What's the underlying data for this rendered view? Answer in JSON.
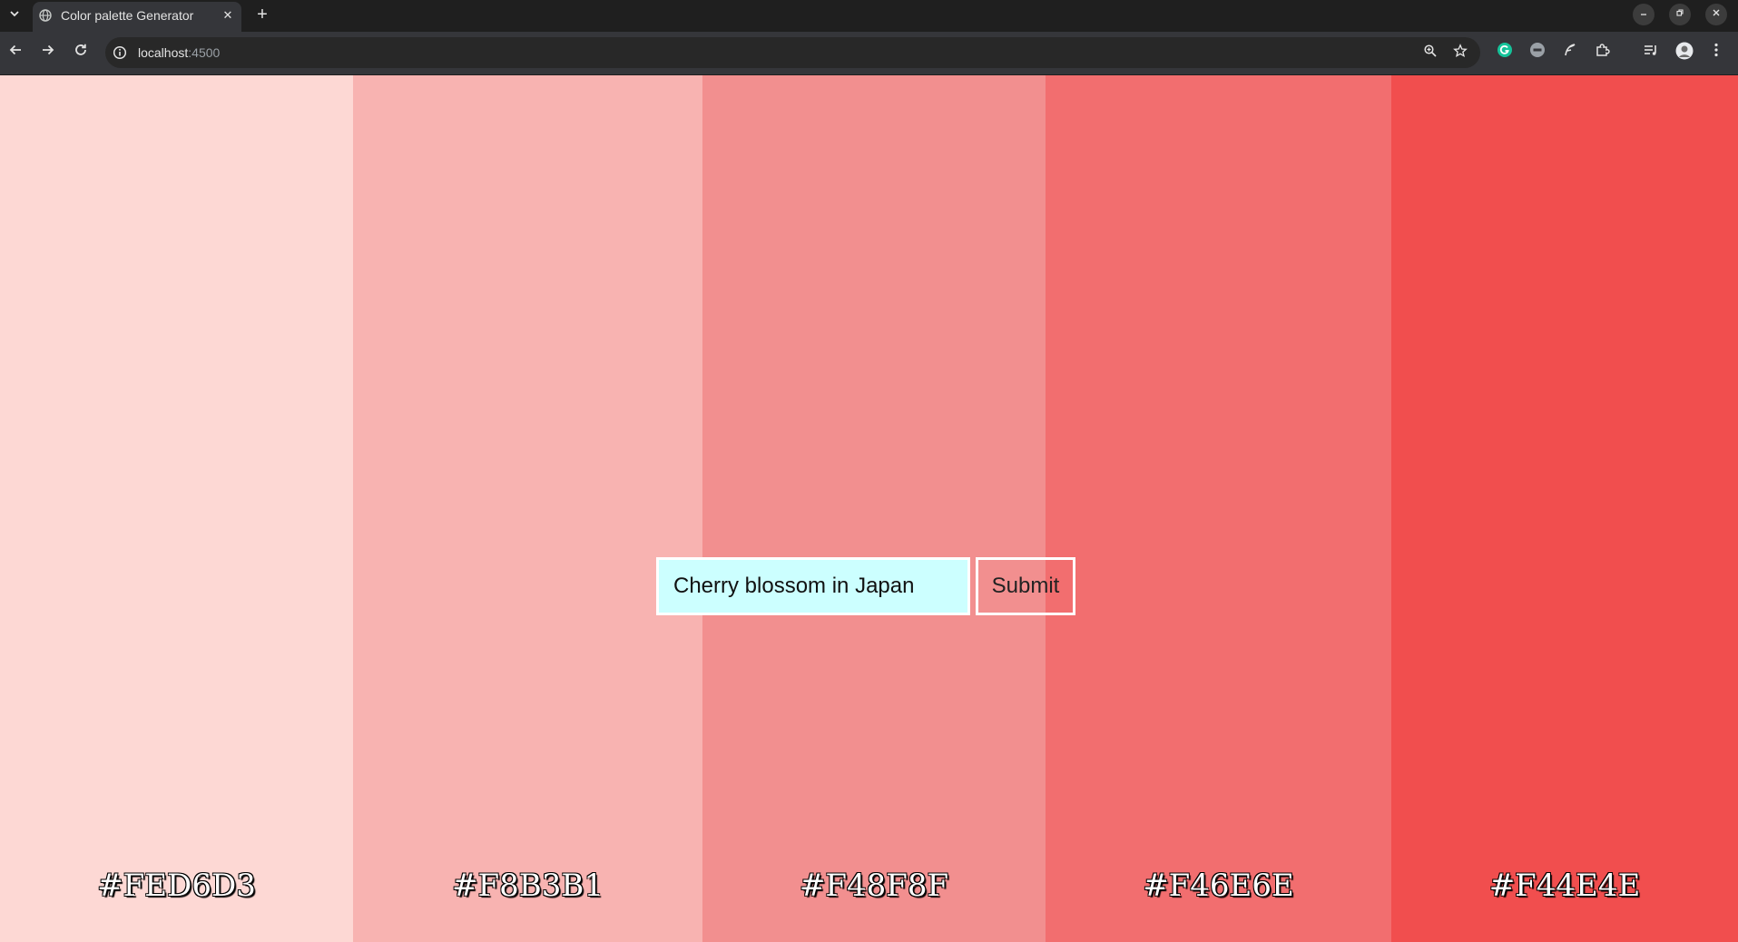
{
  "browser": {
    "tab_title": "Color palette Generator",
    "tab_close": "✕",
    "new_tab": "+",
    "url_host": "localhost",
    "url_port": ":4500"
  },
  "palette": {
    "swatches": [
      {
        "hex": "#FED6D3",
        "color": "#FDD8D4"
      },
      {
        "hex": "#F8B3B1",
        "color": "#F8B3B1"
      },
      {
        "hex": "#F48F8F",
        "color": "#F28F8F"
      },
      {
        "hex": "#F46E6E",
        "color": "#F26E6F"
      },
      {
        "hex": "#F44E4E",
        "color": "#F14E4E"
      }
    ]
  },
  "form": {
    "input_value": "Cherry blossom in Japan",
    "submit_label": "Submit"
  },
  "icons": {
    "tab_search": "tab-search-icon",
    "favicon": "globe-icon",
    "back": "back-arrow-icon",
    "forward": "forward-arrow-icon",
    "reload": "reload-icon",
    "site_info": "info-icon",
    "zoom": "zoom-icon",
    "bookmark": "star-icon"
  }
}
